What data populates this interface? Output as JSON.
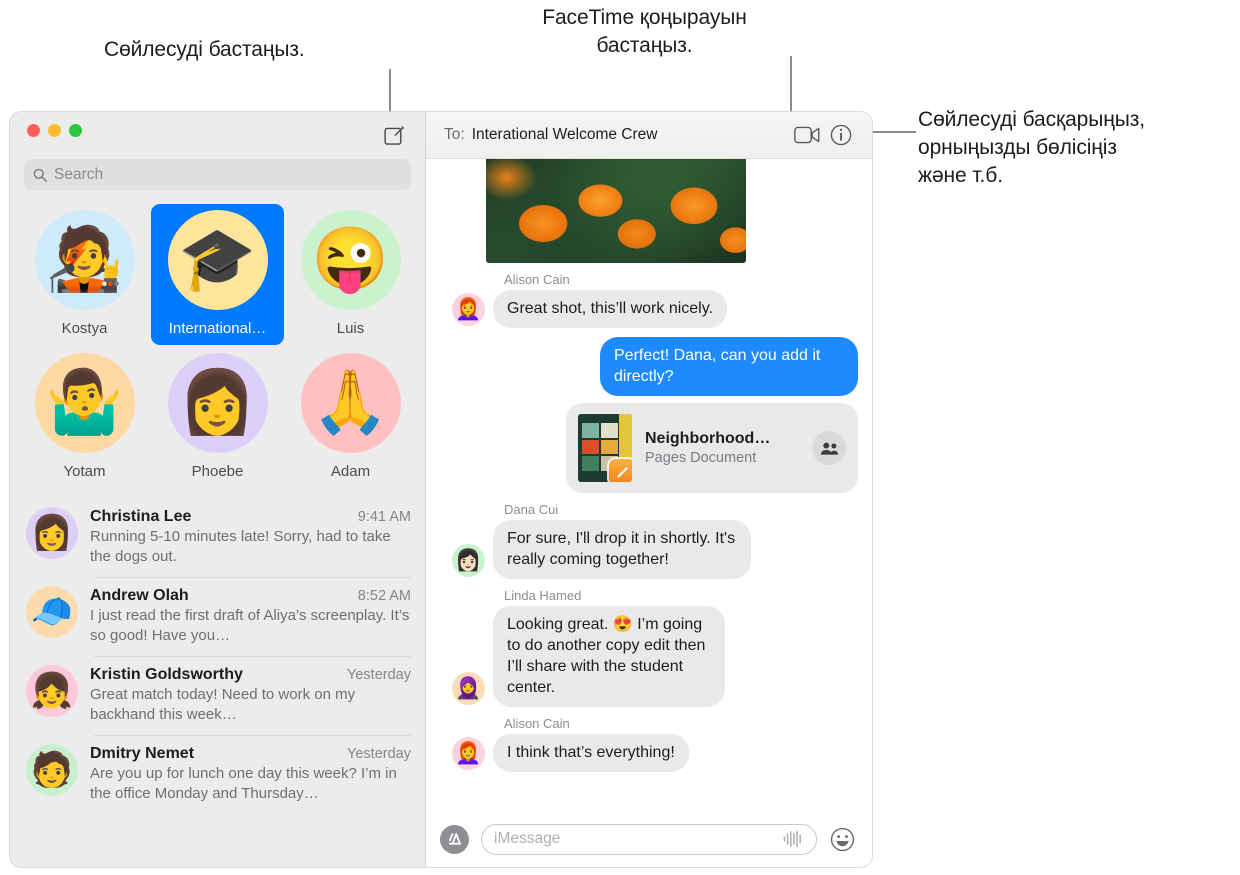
{
  "callouts": [
    {
      "id": "compose",
      "text": "Сөйлесуді бастаңыз."
    },
    {
      "id": "facetime",
      "text": "FaceTime қоңырауын\nбастаңыз."
    },
    {
      "id": "details",
      "text": "Сөйлесуді басқарыңыз,\nорныңызды бөлісіңіз\nжәне т.б."
    }
  ],
  "window": {
    "traffic_lights": [
      "close",
      "minimize",
      "zoom"
    ],
    "compose_icon": "compose-pencil-icon"
  },
  "sidebar": {
    "search": {
      "placeholder": "Search",
      "icon": "search-icon"
    },
    "pinned": [
      {
        "name": "Kostya",
        "emoji": "🧑‍🎤",
        "bg": "#cfeaf9",
        "selected": false
      },
      {
        "name": "International…",
        "emoji": "🎓",
        "bg": "#ffe49c",
        "selected": true
      },
      {
        "name": "Luis",
        "emoji": "😜",
        "bg": "#c9f2cd",
        "selected": false
      },
      {
        "name": "Yotam",
        "emoji": "🤷‍♂️",
        "bg": "#ffd9a3",
        "selected": false
      },
      {
        "name": "Phoebe",
        "emoji": "👩",
        "bg": "#dcd0fb",
        "selected": false
      },
      {
        "name": "Adam",
        "emoji": "🙏",
        "bg": "#ffc0c0",
        "selected": false
      }
    ],
    "conversations": [
      {
        "name": "Christina Lee",
        "time": "9:41 AM",
        "preview": "Running 5-10 minutes late! Sorry, had to take the dogs out.",
        "emoji": "👩",
        "bg": "#ddd0f7"
      },
      {
        "name": "Andrew Olah",
        "time": "8:52 AM",
        "preview": "I just read the first draft of Aliya’s screenplay. It’s so good! Have you…",
        "emoji": "🧢",
        "bg": "#fcdcac"
      },
      {
        "name": "Kristin Goldsworthy",
        "time": "Yesterday",
        "preview": "Great match today! Need to work on my backhand this week…",
        "emoji": "👧",
        "bg": "#fbc9da"
      },
      {
        "name": "Dmitry Nemet",
        "time": "Yesterday",
        "preview": "Are you up for lunch one day this week? I’m in the office Monday and Thursday…",
        "emoji": "🧑",
        "bg": "#c8f0cd"
      }
    ]
  },
  "conversation": {
    "to_label": "To:",
    "to_value": "Interational Welcome Crew",
    "facetime_icon": "video-camera-icon",
    "details_icon": "info-circle-icon",
    "photo_alt": "orange-pansy-flowers-photo",
    "messages": [
      {
        "type": "photo",
        "sender": null,
        "from_me": false
      },
      {
        "type": "text",
        "sender": "Alison Cain",
        "text": "Great shot, this’ll work nicely.",
        "from_me": false,
        "emoji": "👩‍🦰",
        "bg": "#fbd2de"
      },
      {
        "type": "text",
        "sender": null,
        "text": "Perfect! Dana, can you add it directly?",
        "from_me": true
      },
      {
        "type": "document",
        "from_me": true,
        "title": "Neighborhood…",
        "subtitle": "Pages Document",
        "collab_icon": "people-collaboration-icon",
        "app_badge": "pages-app-icon"
      },
      {
        "type": "text",
        "sender": "Dana Cui",
        "text": "For sure, I'll drop it in shortly. It's really coming together!",
        "from_me": false,
        "emoji": "👩🏻",
        "bg": "#c9f3cf"
      },
      {
        "type": "text",
        "sender": "Linda Hamed",
        "text": "Looking great. 😍 I’m going to do another copy edit then I’ll share with the student center.",
        "from_me": false,
        "emoji": "🧕",
        "bg": "#fbdcb9"
      },
      {
        "type": "text",
        "sender": "Alison Cain",
        "text": "I think that’s everything!",
        "from_me": false,
        "emoji": "👩‍🦰",
        "bg": "#fbd2de"
      }
    ],
    "composer": {
      "apps_icon": "app-store-icon",
      "placeholder": "iMessage",
      "audio_icon": "audio-waveform-icon",
      "emoji_icon": "emoji-smiley-icon"
    }
  },
  "colors": {
    "accent_blue": "#007aff",
    "bubble_me": "#1d8aff",
    "bubble_them": "#e9e9eb",
    "sidebar_bg": "#ececec"
  }
}
